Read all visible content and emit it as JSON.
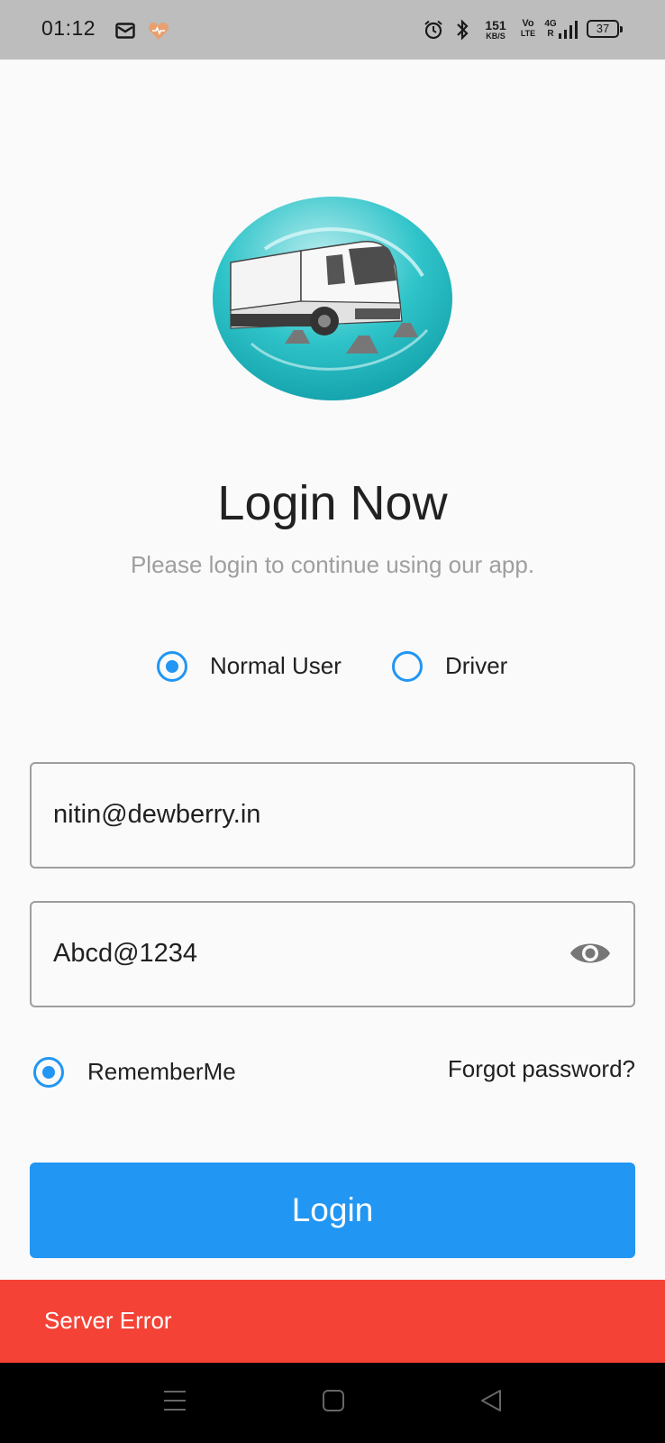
{
  "status_bar": {
    "time": "01:12",
    "net_speed_value": "151",
    "net_speed_unit": "KB/S",
    "volte_top": "Vo",
    "volte_bottom": "LTE",
    "network_type": "4G",
    "network_r": "R",
    "battery": "37",
    "icons": [
      "mail-icon",
      "heart-icon",
      "alarm-icon",
      "bluetooth-icon",
      "signal-icon",
      "battery-icon"
    ]
  },
  "login": {
    "title": "Login Now",
    "subtitle": "Please login to continue using our app.",
    "user_types": [
      {
        "label": "Normal User",
        "selected": true
      },
      {
        "label": "Driver",
        "selected": false
      }
    ],
    "email_value": "nitin@dewberry.in",
    "password_value": "Abcd@1234",
    "remember_label": "RememberMe",
    "remember_checked": true,
    "forgot_label": "Forgot password?",
    "button_label": "Login"
  },
  "snackbar": {
    "message": "Server Error"
  },
  "colors": {
    "accent": "#2196f3",
    "error": "#f44336",
    "status_bar": "#bdbdbd",
    "background": "#fafafa"
  },
  "nav_bar": {
    "icons": [
      "menu-icon",
      "home-icon",
      "back-icon"
    ]
  }
}
